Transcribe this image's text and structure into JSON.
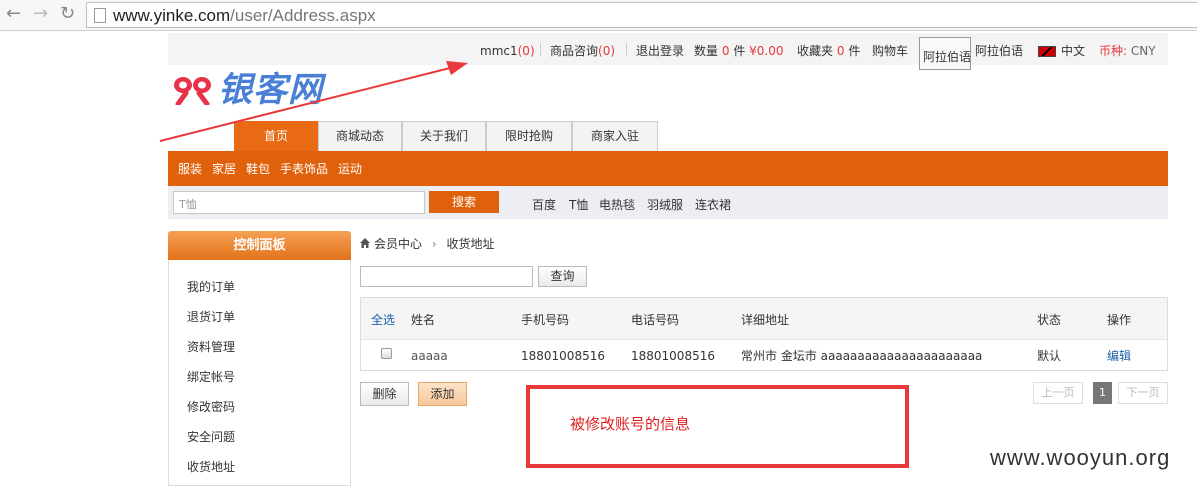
{
  "browser": {
    "url_host": "www.yinke.com",
    "url_path": "/user/Address.aspx"
  },
  "top_bar": {
    "user": "mmc1",
    "user_count": "(0)",
    "consult": "商品咨询",
    "consult_count": "(0)",
    "logout": "退出登录",
    "qty_label": "数量",
    "qty_value": "0",
    "qty_unit": "件",
    "amount": "¥0.00",
    "fav_label": "收藏夹",
    "fav_value": "0",
    "fav_unit": "件",
    "cart": "购物车",
    "lang_box": "阿拉伯语",
    "lang_link": "阿拉伯语",
    "lang_cn": "中文",
    "currency_label": "币种:",
    "currency_value": "CNY"
  },
  "logo": {
    "text": "银客网"
  },
  "tabs": [
    "首页",
    "商城动态",
    "关于我们",
    "限时抢购",
    "商家入驻"
  ],
  "categories": [
    "服装",
    "家居",
    "鞋包",
    "手表饰品",
    "运动"
  ],
  "search": {
    "placeholder": "T恤",
    "button": "搜索",
    "hot": [
      "百度",
      "T恤",
      "电热毯",
      "羽绒服",
      "连衣裙"
    ]
  },
  "sidebar": {
    "title": "控制面板",
    "items": [
      "我的订单",
      "退货订单",
      "资料管理",
      "绑定帐号",
      "修改密码",
      "安全问题",
      "收货地址"
    ]
  },
  "breadcrumb": {
    "home": "会员中心",
    "sep": "›",
    "current": "收货地址"
  },
  "query": {
    "button": "查询"
  },
  "table": {
    "headers": [
      "全选",
      "姓名",
      "手机号码",
      "电话号码",
      "详细地址",
      "状态",
      "操作"
    ],
    "row": {
      "name": "aaaaa",
      "mobile": "18801008516",
      "phone": "18801008516",
      "address": "常州市 金坛市 aaaaaaaaaaaaaaaaaaaaaa",
      "status": "默认",
      "action": "编辑"
    }
  },
  "actions": {
    "delete": "删除",
    "add": "添加"
  },
  "pager": {
    "prev": "上一页",
    "page": "1",
    "next": "下一页"
  },
  "annotation": {
    "text": "被修改账号的信息"
  },
  "watermark": "www.wooyun.org",
  "colors": {
    "accent": "#e0610b",
    "annotation": "#e83a3a",
    "link": "#1a5fa8"
  }
}
